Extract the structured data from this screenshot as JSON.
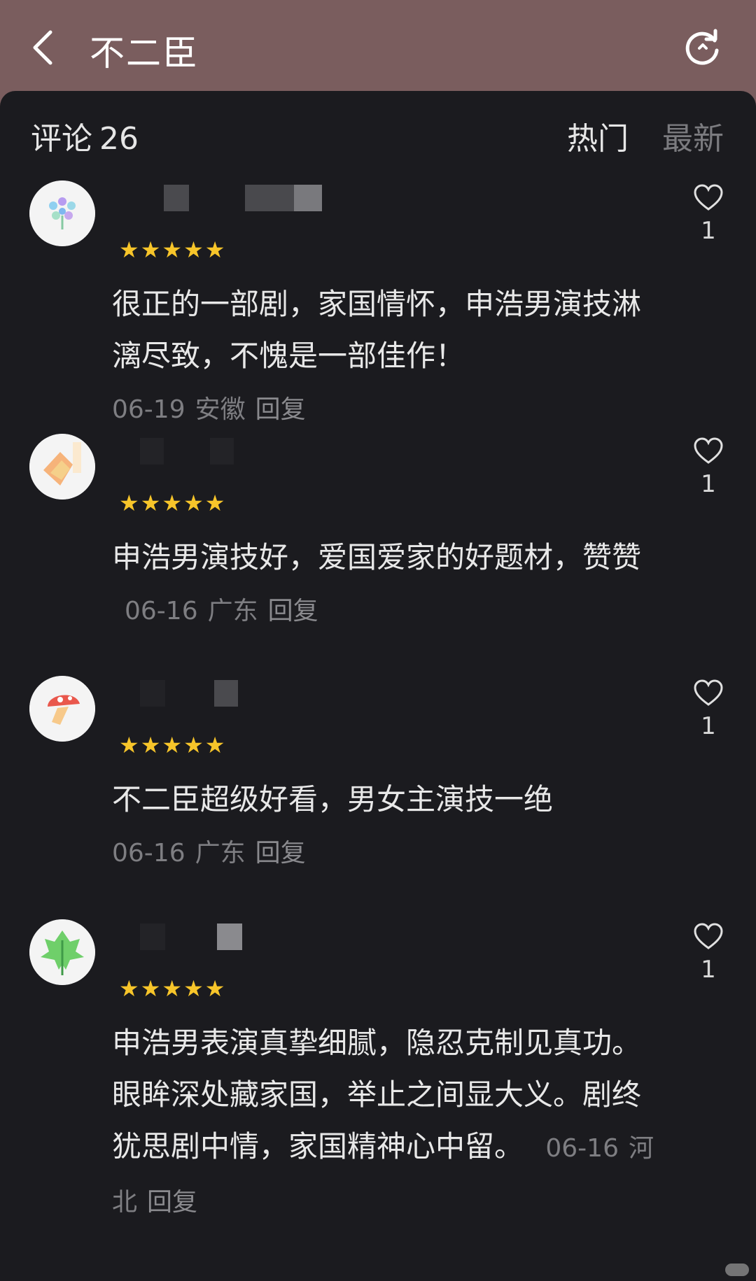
{
  "header": {
    "title": "不二臣"
  },
  "comments_header": {
    "label": "评论",
    "count": "26",
    "tabs": [
      {
        "label": "热门",
        "active": true
      },
      {
        "label": "最新",
        "active": false
      }
    ]
  },
  "comments": [
    {
      "avatar": "flower-avatar-icon",
      "stars": "★★★★★",
      "text": "很正的一部剧，家国情怀，申浩男演技淋漓尽致，不愧是一部佳作！",
      "date": "06-19",
      "location": "安徽",
      "reply": "回复",
      "likes": "1"
    },
    {
      "avatar": "sunset-avatar-icon",
      "stars": "★★★★★",
      "text": "申浩男演技好，爱国爱家的好题材，赞赞",
      "date": "06-16",
      "location": "广东",
      "reply": "回复",
      "likes": "1"
    },
    {
      "avatar": "mushroom-avatar-icon",
      "stars": "★★★★★",
      "text": "不二臣超级好看，男女主演技一绝",
      "date": "06-16",
      "location": "广东",
      "reply": "回复",
      "likes": "1"
    },
    {
      "avatar": "leaf-avatar-icon",
      "stars": "★★★★★",
      "text": "申浩男表演真挚细腻，隐忍克制见真功。眼眸深处藏家国，举止之间显大义。剧终犹思剧中情，家国精神心中留。",
      "date": "06-16",
      "location": "河北",
      "reply": "回复",
      "likes": "1"
    }
  ],
  "colors": {
    "topbar": "#7a5d5e",
    "sheet": "#1b1b1f",
    "star": "#f7c52a"
  }
}
